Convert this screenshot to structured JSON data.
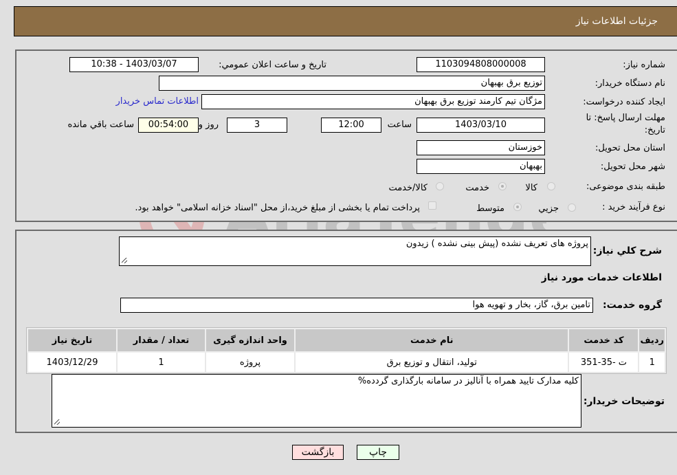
{
  "header": {
    "title": "جزئیات اطلاعات نیاز"
  },
  "details": {
    "need_number_label": "شماره نیاز:",
    "need_number": "1103094808000008",
    "announce_label": "تاریخ و ساعت اعلان عمومي:",
    "announce_value": "1403/03/07 - 10:38",
    "buyer_org_label": "نام دستگاه خريدار:",
    "buyer_org": "توزیع برق بهبهان",
    "creator_label": "ايجاد کننده درخواست:",
    "creator": "مژگان تیم کارمند توزیع برق بهبهان",
    "contact_link": "اطلاعات تماس خريدار",
    "deadline_label_line1": "مهلت ارسال پاسخ: تا",
    "deadline_label_line2": "تاریخ:",
    "deadline_date": "1403/03/10",
    "time_label": "ساعت",
    "deadline_time": "12:00",
    "days_value": "3",
    "days_label": "روز و",
    "remaining_time": "00:54:00",
    "remaining_label": "ساعت باقي مانده",
    "province_label": "استان محل تحویل:",
    "province": "خوزستان",
    "city_label": "شهر محل تحویل:",
    "city": "بهبهان",
    "category_label": "طبقه بندی موضوعی:",
    "category_options": [
      {
        "label": "کالا",
        "checked": false
      },
      {
        "label": "خدمت",
        "checked": true
      },
      {
        "label": "کالا/خدمت",
        "checked": false
      }
    ],
    "process_label": "نوع فرآيند خريد :",
    "process_options": [
      {
        "label": "جزيي",
        "checked": false
      },
      {
        "label": "متوسط",
        "checked": true
      }
    ],
    "treasury_note": "پرداخت تمام یا بخشی از مبلغ خرید،از محل \"اسناد خزانه اسلامی\" خواهد بود."
  },
  "description": {
    "label": "شرح کلي نياز:",
    "value": "پروژه های تعریف نشده (پیش بینی نشده ) زیدون"
  },
  "services": {
    "section_title": "اطلاعات خدمات مورد نیاز",
    "group_label": "گروه خدمت:",
    "group_value": "تامین برق، گاز، بخار و تهویه هوا",
    "columns": [
      "رديف",
      "کد خدمت",
      "نام خدمت",
      "واحد اندازه گيری",
      "تعداد / مقدار",
      "تاريخ نياز"
    ],
    "rows": [
      [
        "1",
        "ت -35-351",
        "تولید، انتقال و توزیع برق",
        "پروژه",
        "1",
        "1403/12/29"
      ]
    ]
  },
  "buyer_notes": {
    "label": "توضيحات خريدار:",
    "value": "کلیه مدارک تایید همراه با آنالیز در سامانه بارگذاری گردده%"
  },
  "buttons": {
    "print": "چاپ",
    "back": "بازگشت"
  },
  "colors": {
    "header_bg": "#8d6e45",
    "link": "#2a2acc",
    "print_bg": "#eaffea",
    "back_bg": "#ffdede"
  }
}
